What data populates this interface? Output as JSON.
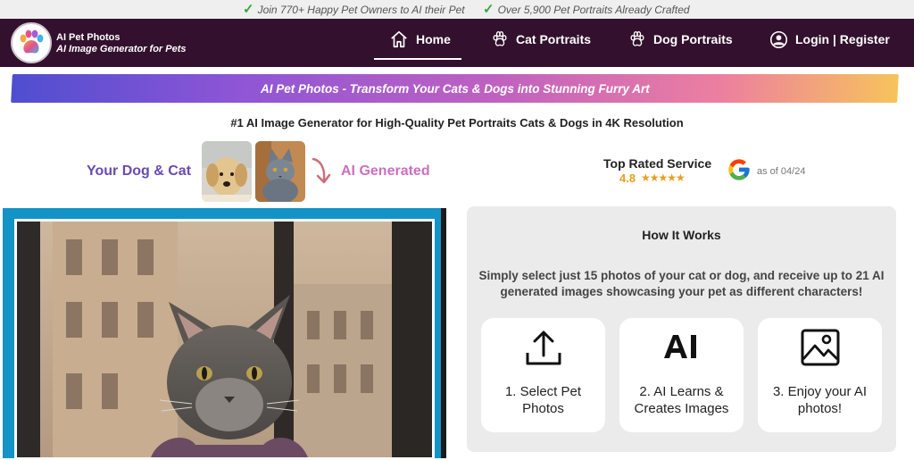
{
  "topbar": {
    "promo_1": "Join 770+ Happy Pet Owners to AI their Pet",
    "promo_2": "Over 5,900 Pet Portraits Already Crafted",
    "check_color": "#3aa640"
  },
  "header": {
    "brand_title": "AI Pet Photos",
    "brand_subtitle": "AI Image Generator for Pets",
    "bg_color": "#33102e",
    "nav": [
      {
        "label": "Home",
        "icon": "home-icon",
        "active": true
      },
      {
        "label": "Cat Portraits",
        "icon": "paw-icon",
        "active": false
      },
      {
        "label": "Dog Portraits",
        "icon": "paw-icon",
        "active": false
      },
      {
        "label": "Login | Register",
        "icon": "user-circle-icon",
        "active": false
      }
    ]
  },
  "banner": {
    "text": "AI Pet Photos - Transform Your Cats & Dogs into Stunning Furry Art"
  },
  "headline": "#1 AI Image Generator for High-Quality Pet Portraits Cats & Dogs in 4K Resolution",
  "comparison": {
    "left_label": "Your Dog & Cat",
    "right_label": "AI Generated",
    "thumbnails": [
      "dog-photo",
      "cat-photo"
    ]
  },
  "rating": {
    "title": "Top Rated Service",
    "score": "4.8",
    "stars": "★★★★★",
    "as_of": "as of 04/24",
    "provider_icon": "google-icon"
  },
  "how_it_works": {
    "title": "How It Works",
    "description": "Simply select just 15 photos of your cat or dog, and receive up to 21 AI generated images showcasing your pet as different characters!",
    "steps": [
      {
        "label": "1. Select Pet Photos",
        "icon": "upload-icon"
      },
      {
        "label": "2. AI Learns & Creates Images",
        "icon": "ai-icon"
      },
      {
        "label": "3. Enjoy your AI photos!",
        "icon": "image-icon"
      }
    ]
  },
  "featured_image": {
    "frame_color": "#1493c6",
    "subject": "cat-portrait"
  }
}
